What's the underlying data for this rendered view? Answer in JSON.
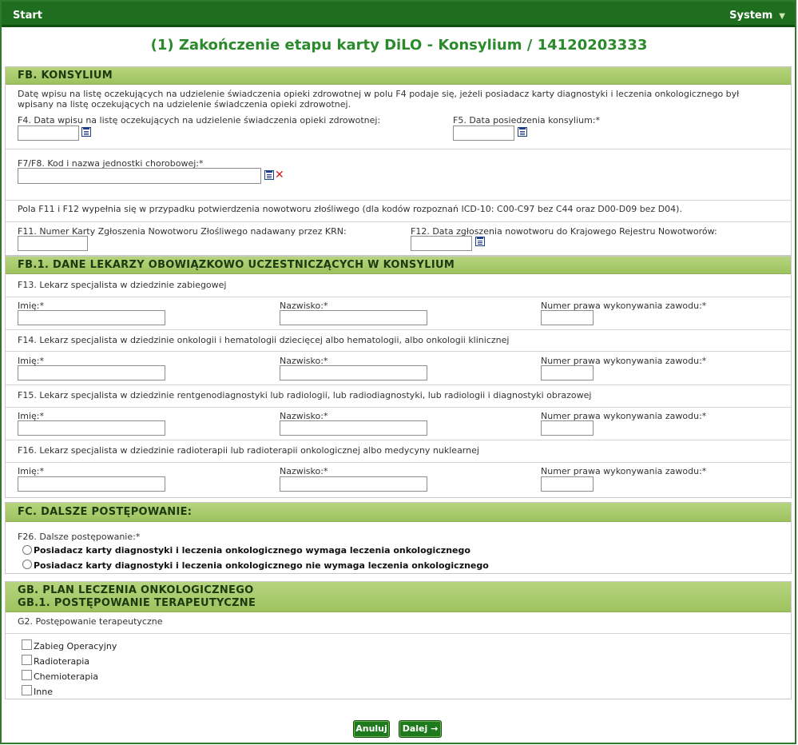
{
  "topbar": {
    "start": "Start",
    "system": "System",
    "caret": "▼"
  },
  "page_title": "(1) Zakończenie etapu karty DiLO - Konsylium / 14120203333",
  "fb": {
    "title": "FB. KONSYLIUM",
    "note": "Datę wpisu na listę oczekujących na udzielenie świadczenia opieki zdrowotnej w polu F4 podaje się, jeżeli posiadacz karty diagnostyki i leczenia onkologicznego był wpisany na listę oczekujących na udzielenie świadczenia opieki zdrowotnej.",
    "f4_label": "F4. Data wpisu na listę oczekujących na udzielenie świadczenia opieki zdrowotnej:",
    "f5_label": "F5. Data posiedzenia konsylium:*",
    "f7f8_label": "F7/F8. Kod i nazwa jednostki chorobowej:*",
    "f11f12_note": "Pola F11 i F12 wypełnia się w przypadku potwierdzenia nowotworu złośliwego (dla kodów rozpoznań ICD-10: C00-C97 bez C44 oraz D00-D09 bez D04).",
    "f11_label": "F11. Numer Karty Zgłoszenia Nowotworu Złośliwego nadawany przez KRN:",
    "f12_label": "F12. Data zgłoszenia nowotworu do Krajowego Rejestru Nowotworów:"
  },
  "fb1": {
    "title": "FB.1. DANE LEKARZY OBOWIĄZKOWO UCZESTNICZĄCYCH W KONSYLIUM",
    "first_name_label": "Imię:*",
    "last_name_label": "Nazwisko:*",
    "license_label": "Numer prawa wykonywania zawodu:*",
    "f13": "F13. Lekarz specjalista w dziedzinie zabiegowej",
    "f14": "F14. Lekarz specjalista w dziedzinie onkologii i hematologii dziecięcej albo hematologii, albo onkologii klinicznej",
    "f15": "F15. Lekarz specjalista w dziedzinie rentgenodiagnostyki lub radiologii, lub radiodiagnostyki, lub radiologii i diagnostyki obrazowej",
    "f16": "F16. Lekarz specjalista w dziedzinie radioterapii lub radioterapii onkologicznej albo medycyny nuklearnej"
  },
  "fc": {
    "title": "FC. DALSZE POSTĘPOWANIE:",
    "f26_label": "F26. Dalsze postępowanie:*",
    "option1": "Posiadacz karty diagnostyki i leczenia onkologicznego wymaga leczenia onkologicznego",
    "option2": "Posiadacz karty diagnostyki i leczenia onkologicznego nie wymaga leczenia onkologicznego"
  },
  "gb": {
    "title1": "GB. PLAN LECZENIA ONKOLOGICZNEGO",
    "title2": "GB.1. POSTĘPOWANIE TERAPEUTYCZNE",
    "g2_label": "G2. Postępowanie terapeutyczne",
    "checkboxes": [
      "Zabieg Operacyjny",
      "Radioterapia",
      "Chemioterapia",
      "Inne"
    ]
  },
  "buttons": {
    "cancel": "Anuluj",
    "next": "Dalej →"
  }
}
